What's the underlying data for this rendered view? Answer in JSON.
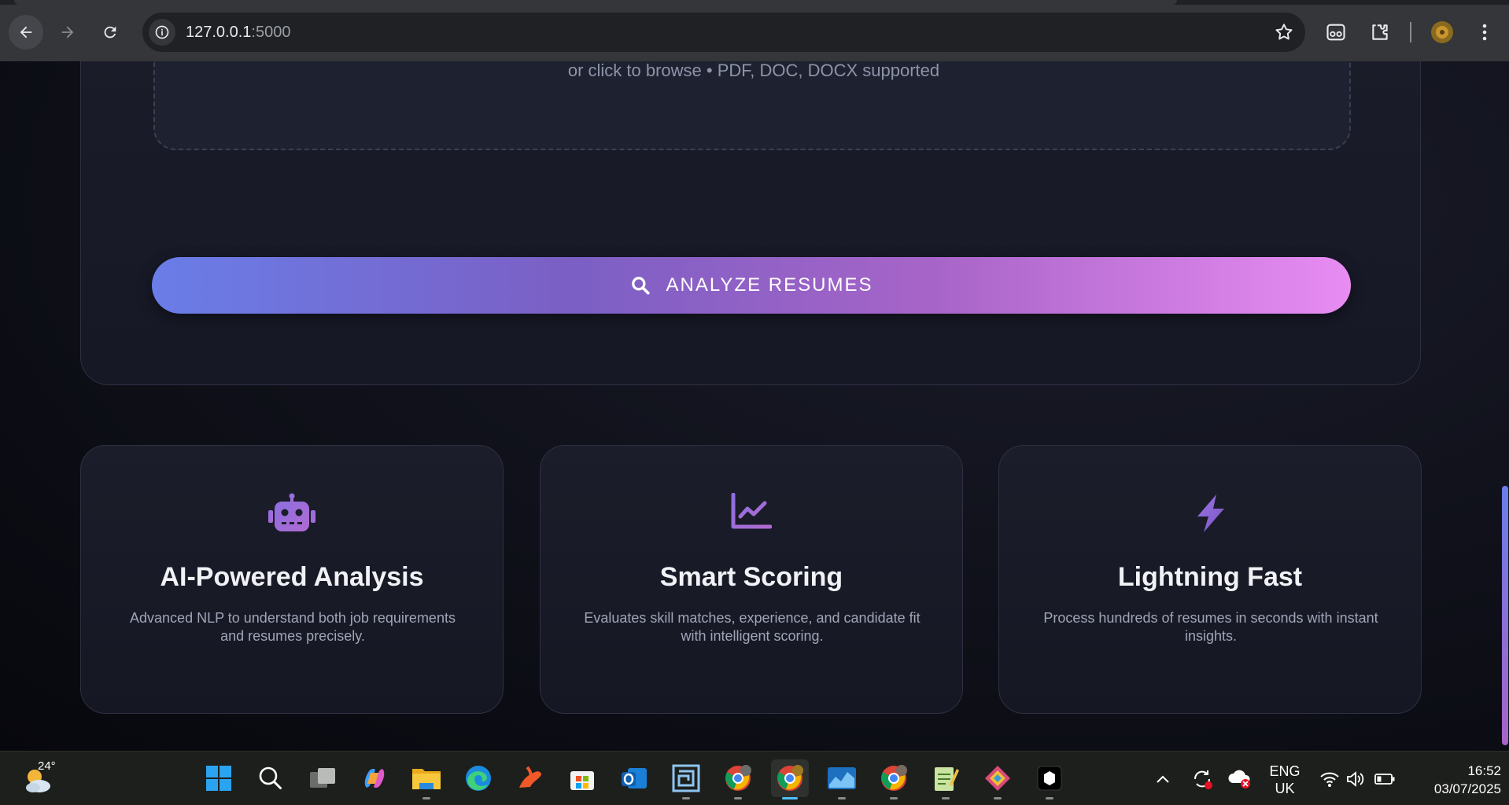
{
  "browser": {
    "url_host": "127.0.0.1",
    "url_port": ":5000",
    "icons": [
      "back-icon",
      "forward-icon",
      "reload-icon",
      "site-info-icon",
      "bookmark-star-icon",
      "reading-mode-icon",
      "extensions-icon",
      "profile-avatar",
      "menu-icon"
    ]
  },
  "upload": {
    "hint": "or click to browse • PDF, DOC, DOCX supported"
  },
  "analyze": {
    "label": "ANALYZE RESUMES",
    "icon": "search-icon",
    "gradient": [
      "#6a7de8",
      "#7b5fc4",
      "#a764c8",
      "#e88cf2"
    ]
  },
  "features": [
    {
      "icon": "robot-icon",
      "title": "AI-Powered Analysis",
      "description": "Advanced NLP to understand both job requirements and resumes precisely."
    },
    {
      "icon": "line-chart-icon",
      "title": "Smart Scoring",
      "description": "Evaluates skill matches, experience, and candidate fit with intelligent scoring."
    },
    {
      "icon": "lightning-icon",
      "title": "Lightning Fast",
      "description": "Process hundreds of resumes in seconds with instant insights."
    }
  ],
  "taskbar": {
    "weather_temp": "24°",
    "apps": [
      "start-icon",
      "search-icon",
      "task-view-icon",
      "copilot-icon",
      "file-explorer-icon",
      "edge-icon",
      "app-icon",
      "microsoft-store-icon",
      "outlook-icon",
      "maze-app-icon",
      "chrome-icon",
      "chrome-icon",
      "charts-app-icon",
      "chrome-icon",
      "notepad-icon",
      "app-icon",
      "terminal-icon"
    ],
    "lang_line1": "ENG",
    "lang_line2": "UK",
    "time": "16:52",
    "date": "03/07/2025"
  },
  "colors": {
    "accent_purple": "#9b6cd8",
    "page_bg": "#0b0c14",
    "card_bg": "#1a1c29"
  }
}
